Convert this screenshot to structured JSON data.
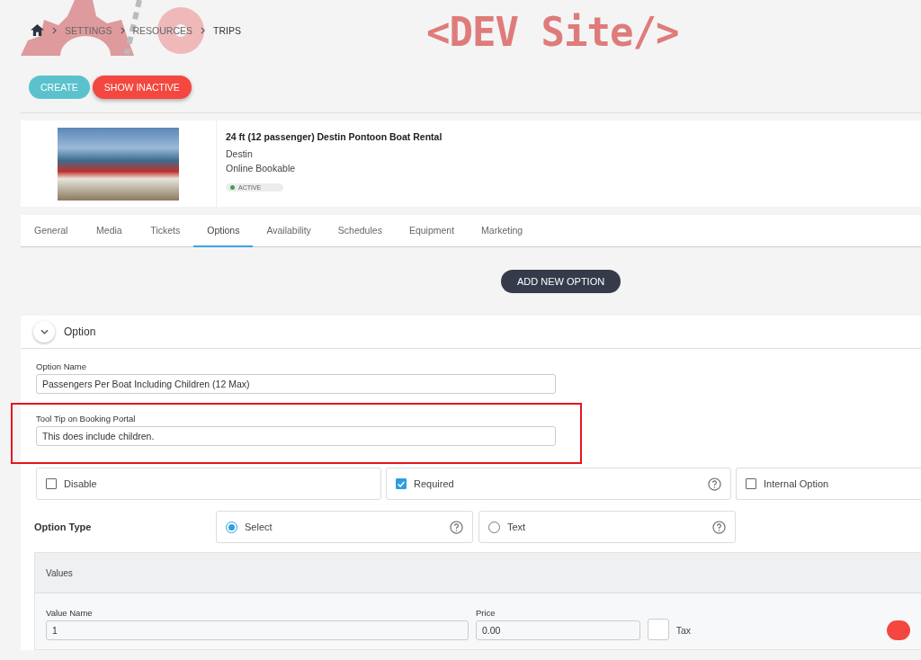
{
  "breadcrumb": [
    {
      "label": "SETTINGS"
    },
    {
      "label": "RESOURCES"
    },
    {
      "label": "TRIPS"
    }
  ],
  "dev_banner": "<DEV Site/>",
  "actions": [
    {
      "label": "CREATE",
      "kind": "primary"
    },
    {
      "label": "SHOW INACTIVE",
      "kind": "danger"
    }
  ],
  "trip": {
    "title": "24 ft (12 passenger) Destin Pontoon Boat Rental",
    "location": "Destin",
    "booking": "Online Bookable",
    "status": {
      "label": "ACTIVE",
      "color": "#43a047"
    }
  },
  "tabs": [
    {
      "label": "General",
      "selected": false
    },
    {
      "label": "Media",
      "selected": false
    },
    {
      "label": "Tickets",
      "selected": false
    },
    {
      "label": "Options",
      "selected": true
    },
    {
      "label": "Availability",
      "selected": false
    },
    {
      "label": "Schedules",
      "selected": false
    },
    {
      "label": "Equipment",
      "selected": false
    },
    {
      "label": "Marketing",
      "selected": false
    }
  ],
  "add_button": "ADD NEW OPTION",
  "option": {
    "title": "Option",
    "fields": [
      {
        "label": "Option Name",
        "value": "Passengers Per Boat Including Children (12 Max)",
        "highlighted": false
      },
      {
        "label": "Tool Tip on Booking Portal",
        "value": "This does include children.",
        "highlighted": true
      }
    ],
    "flags": [
      {
        "label": "Disable",
        "checked": false,
        "help": false
      },
      {
        "label": "Required",
        "checked": true,
        "help": true
      },
      {
        "label": "Internal Option",
        "checked": false,
        "help": false
      }
    ],
    "option_type": {
      "label": "Option Type",
      "choices": [
        {
          "label": "Select",
          "selected": true
        },
        {
          "label": "Text",
          "selected": false
        }
      ]
    },
    "values": {
      "title": "Values",
      "rows": [
        {
          "name_label": "Value Name",
          "name": "1",
          "price_label": "Price",
          "price": "0.00",
          "tax_label": "Tax",
          "tax_checked": false
        }
      ]
    }
  }
}
